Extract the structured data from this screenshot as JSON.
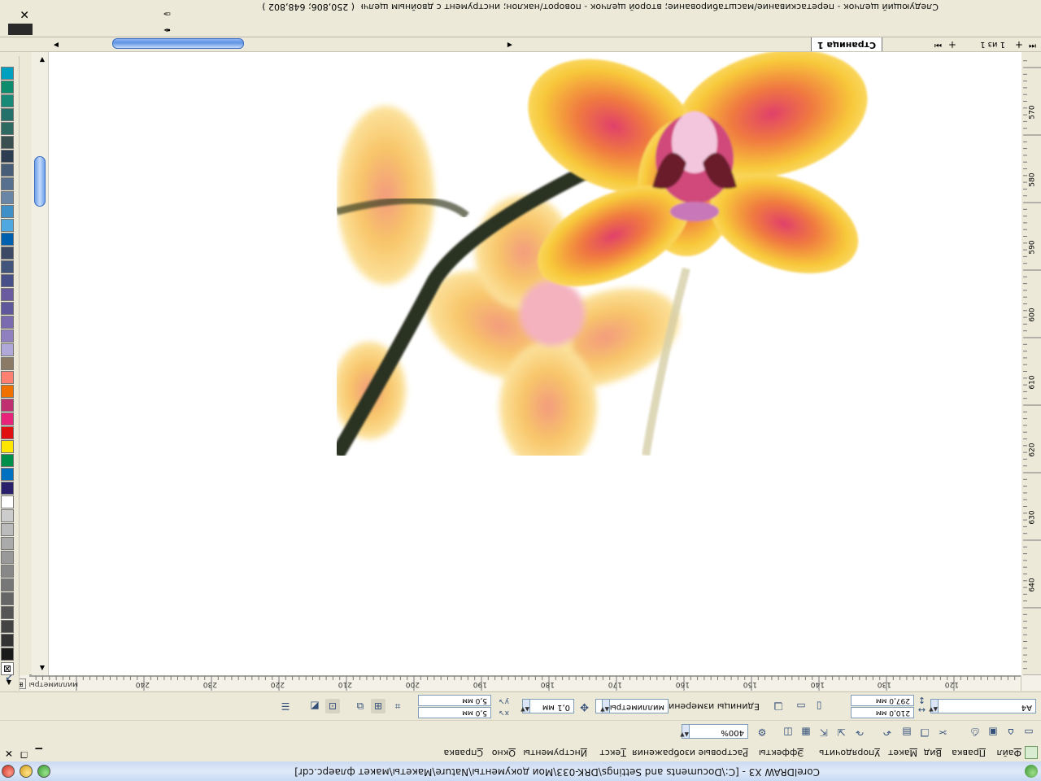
{
  "window": {
    "title": "CorelDRAW X3 - [C:\\Documents and Settings\\DRK-033\\Мои документы\\Nature\\Макеты\\макет флаерс.cdr]"
  },
  "menu": [
    "Файл",
    "Правка",
    "Вид",
    "Макет",
    "Упорядочить",
    "Эффекты",
    "Растровые изображения",
    "Текст",
    "Инструменты",
    "Окно",
    "Справка"
  ],
  "toolbar": {
    "zoom": "400%"
  },
  "properties": {
    "paper_size": "A4",
    "width": "210,0 мм",
    "height": "297,0 мм",
    "units_label": "Единицы измерения:",
    "units_value": "миллиметры",
    "nudge": "0,1 мм",
    "dup_x": "5,0 мм",
    "dup_y": "5,0 мм"
  },
  "rulers": {
    "unit": "миллиметры",
    "h_ticks": [
      "120",
      "130",
      "140",
      "150",
      "160",
      "170",
      "180",
      "190",
      "200",
      "210",
      "220",
      "230",
      "240",
      "250"
    ],
    "v_ticks": [
      "570",
      "580",
      "590",
      "600",
      "610",
      "620",
      "630",
      "640"
    ]
  },
  "pages": {
    "tab_label": "Страница 1",
    "counter": "1 из 1"
  },
  "status": {
    "coords": "( 250,806; 648,802 )",
    "hint": "Следующий щелчок - перетаскивание/масштабирование; второй щелчок - поворот/наклон; инструмент с двойным щелчком выбирает вс..."
  },
  "palette_colors": [
    "#1a1a1a",
    "#333333",
    "#444444",
    "#555555",
    "#666666",
    "#777777",
    "#888888",
    "#999999",
    "#aaaaaa",
    "#bbbbbb",
    "#cccccc",
    "#ffffff",
    "#2a1f6b",
    "#0070c0",
    "#00904a",
    "#ffe600",
    "#e01010",
    "#e8247a",
    "#c03070",
    "#f07000",
    "#ff8070",
    "#8b7a66",
    "#b0a8d8",
    "#9080c0",
    "#7a6ab0",
    "#60589c",
    "#6a5aa0",
    "#48508a",
    "#40547c",
    "#3c4a66",
    "#0060b0",
    "#50a8e0",
    "#4090c8",
    "#6a86a6",
    "#587090",
    "#485e78",
    "#2e3e52",
    "#3a5050",
    "#2f6a62",
    "#24706a",
    "#1a8a78",
    "#0d8c6e",
    "#00a0c0"
  ],
  "colors": {
    "accent": "#3a6fc4",
    "canvas": "#ffffff",
    "chrome": "#ece9d8"
  }
}
